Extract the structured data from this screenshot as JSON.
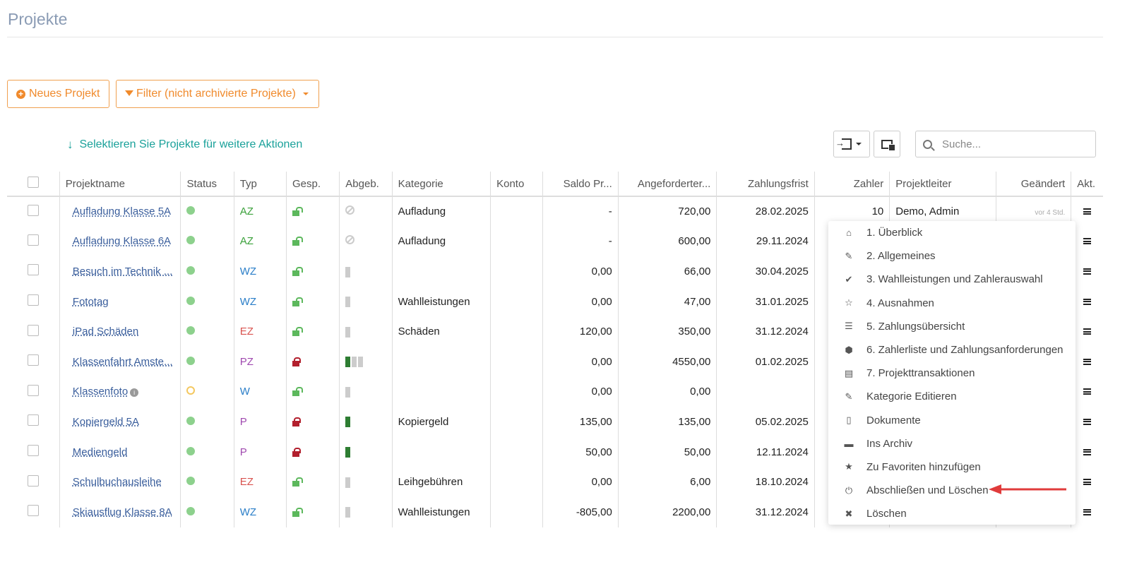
{
  "page": {
    "title": "Projekte"
  },
  "toolbar": {
    "new_project_label": "Neues Projekt",
    "filter_label": "Filter (nicht archivierte Projekte)",
    "select_hint": "Selektieren Sie Projekte für weitere Aktionen",
    "search_placeholder": "Suche..."
  },
  "table": {
    "headers": [
      "Projektname",
      "Status",
      "Typ",
      "Gesp.",
      "Abgeb.",
      "Kategorie",
      "Konto",
      "Saldo Pr...",
      "Angeforderter...",
      "Zahlungsfrist",
      "Zahler",
      "Projektleiter",
      "Geändert",
      "Akt."
    ],
    "rows": [
      {
        "name": "Aufladung Klasse 5A",
        "status": "active",
        "typ": "AZ",
        "typ_color": "#3ba13b",
        "locked": false,
        "abgeb": "none",
        "kategorie": "Aufladung",
        "konto": "",
        "saldo": "-",
        "angefordert": "720,00",
        "frist": "28.02.2025",
        "zahler": "10",
        "leiter": "Demo, Admin",
        "geaendert": "vor 4 Std."
      },
      {
        "name": "Aufladung Klasse 6A",
        "status": "active",
        "typ": "AZ",
        "typ_color": "#3ba13b",
        "locked": false,
        "abgeb": "none",
        "kategorie": "Aufladung",
        "konto": "",
        "saldo": "-",
        "angefordert": "600,00",
        "frist": "29.11.2024",
        "zahler": "",
        "leiter": "",
        "geaendert": ""
      },
      {
        "name": "Besuch im Technik ...",
        "status": "active",
        "typ": "WZ",
        "typ_color": "#2a7ec8",
        "locked": false,
        "abgeb": "grey1",
        "kategorie": "",
        "konto": "",
        "saldo": "0,00",
        "angefordert": "66,00",
        "frist": "30.04.2025",
        "zahler": "",
        "leiter": "",
        "geaendert": ""
      },
      {
        "name": "Fototag",
        "status": "active",
        "typ": "WZ",
        "typ_color": "#2a7ec8",
        "locked": false,
        "abgeb": "grey1",
        "kategorie": "Wahlleistungen",
        "konto": "",
        "saldo": "0,00",
        "angefordert": "47,00",
        "frist": "31.01.2025",
        "zahler": "",
        "leiter": "",
        "geaendert": ""
      },
      {
        "name": "iPad Schäden",
        "status": "active",
        "typ": "EZ",
        "typ_color": "#d9534f",
        "locked": false,
        "abgeb": "grey1",
        "kategorie": "Schäden",
        "konto": "",
        "saldo": "120,00",
        "angefordert": "350,00",
        "frist": "31.12.2024",
        "zahler": "",
        "leiter": "",
        "geaendert": ""
      },
      {
        "name": "Klassenfahrt Amste...",
        "status": "active",
        "typ": "PZ",
        "typ_color": "#a04ab0",
        "locked": true,
        "abgeb": "mix",
        "kategorie": "",
        "konto": "",
        "saldo": "0,00",
        "angefordert": "4550,00",
        "frist": "01.02.2025",
        "zahler": "",
        "leiter": "",
        "geaendert": ""
      },
      {
        "name": "Klassenfoto",
        "status": "pending",
        "typ": "W",
        "typ_color": "#2a7ec8",
        "locked": false,
        "abgeb": "grey1",
        "kategorie": "",
        "konto": "",
        "saldo": "0,00",
        "angefordert": "0,00",
        "frist": "",
        "zahler": "",
        "leiter": "",
        "geaendert": "",
        "info": true
      },
      {
        "name": "Kopiergeld 5A",
        "status": "active",
        "typ": "P",
        "typ_color": "#a04ab0",
        "locked": true,
        "abgeb": "green1",
        "kategorie": "Kopiergeld",
        "konto": "",
        "saldo": "135,00",
        "angefordert": "135,00",
        "frist": "05.02.2025",
        "zahler": "",
        "leiter": "",
        "geaendert": ""
      },
      {
        "name": "Mediengeld",
        "status": "active",
        "typ": "P",
        "typ_color": "#a04ab0",
        "locked": true,
        "abgeb": "green1",
        "kategorie": "",
        "konto": "",
        "saldo": "50,00",
        "angefordert": "50,00",
        "frist": "12.11.2024",
        "zahler": "",
        "leiter": "",
        "geaendert": ""
      },
      {
        "name": "Schulbuchausleihe",
        "status": "active",
        "typ": "EZ",
        "typ_color": "#d9534f",
        "locked": false,
        "abgeb": "grey1",
        "kategorie": "Leihgebühren",
        "konto": "",
        "saldo": "0,00",
        "angefordert": "6,00",
        "frist": "18.10.2024",
        "zahler": "",
        "leiter": "",
        "geaendert": ""
      },
      {
        "name": "Skiausflug Klasse 8A",
        "status": "active",
        "typ": "WZ",
        "typ_color": "#2a7ec8",
        "locked": false,
        "abgeb": "grey1",
        "kategorie": "Wahlleistungen",
        "konto": "",
        "saldo": "-805,00",
        "angefordert": "2200,00",
        "frist": "31.12.2024",
        "zahler": "",
        "leiter": "",
        "geaendert": ""
      }
    ]
  },
  "dropdown": {
    "items": [
      {
        "label": "1. Überblick",
        "icon": "home-icon",
        "glyph": "⌂"
      },
      {
        "label": "2. Allgemeines",
        "icon": "pencil-icon",
        "glyph": "✎"
      },
      {
        "label": "3. Wahlleistungen und Zahlerauswahl",
        "icon": "check-icon",
        "glyph": "✔"
      },
      {
        "label": "4. Ausnahmen",
        "icon": "star-outline-icon",
        "glyph": "☆"
      },
      {
        "label": "5. Zahlungsübersicht",
        "icon": "server-icon",
        "glyph": "☰"
      },
      {
        "label": "6. Zahlerliste und Zahlungsanforderungen",
        "icon": "cube-icon",
        "glyph": "⬢"
      },
      {
        "label": "7. Projekttransaktionen",
        "icon": "list-alt-icon",
        "glyph": "▤"
      },
      {
        "label": "Kategorie Editieren",
        "icon": "pencil-icon",
        "glyph": "✎"
      },
      {
        "label": "Dokumente",
        "icon": "file-icon",
        "glyph": "▯"
      },
      {
        "label": "Ins Archiv",
        "icon": "archive-icon",
        "glyph": "▬"
      },
      {
        "label": "Zu Favoriten hinzufügen",
        "icon": "star-icon",
        "glyph": "★"
      },
      {
        "label": "Abschließen und Löschen",
        "icon": "power-icon",
        "glyph": "⏻"
      },
      {
        "label": "Löschen",
        "icon": "times-icon",
        "glyph": "✖"
      }
    ]
  },
  "colors": {
    "accent": "#f08a2c",
    "teal": "#1aa19a",
    "link": "#3a5e9c",
    "title": "#8a9bb4",
    "arrow": "#e03b3b"
  }
}
